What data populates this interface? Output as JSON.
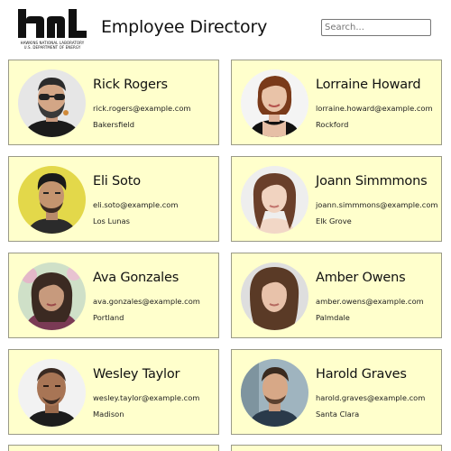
{
  "header": {
    "logo": {
      "text": "hnl",
      "line1": "HAWKINS NATIONAL LABORATORY",
      "line2": "U.S. DEPARTMENT OF ENERGY"
    },
    "title": "Employee Directory",
    "search": {
      "placeholder": "Search...",
      "value": ""
    }
  },
  "employees": [
    {
      "name": "Rick Rogers",
      "email": "rick.rogers@example.com",
      "city": "Bakersfield"
    },
    {
      "name": "Lorraine Howard",
      "email": "lorraine.howard@example.com",
      "city": "Rockford"
    },
    {
      "name": "Eli Soto",
      "email": "eli.soto@example.com",
      "city": "Los Lunas"
    },
    {
      "name": "Joann Simmmons",
      "email": "joann.simmmons@example.com",
      "city": "Elk Grove"
    },
    {
      "name": "Ava Gonzales",
      "email": "ava.gonzales@example.com",
      "city": "Portland"
    },
    {
      "name": "Amber Owens",
      "email": "amber.owens@example.com",
      "city": "Palmdale"
    },
    {
      "name": "Wesley Taylor",
      "email": "wesley.taylor@example.com",
      "city": "Madison"
    },
    {
      "name": "Harold Graves",
      "email": "harold.graves@example.com",
      "city": "Santa Clara"
    }
  ],
  "colors": {
    "card_background": "#ffffcc",
    "card_border": "#9a9a88",
    "text": "#111111"
  }
}
